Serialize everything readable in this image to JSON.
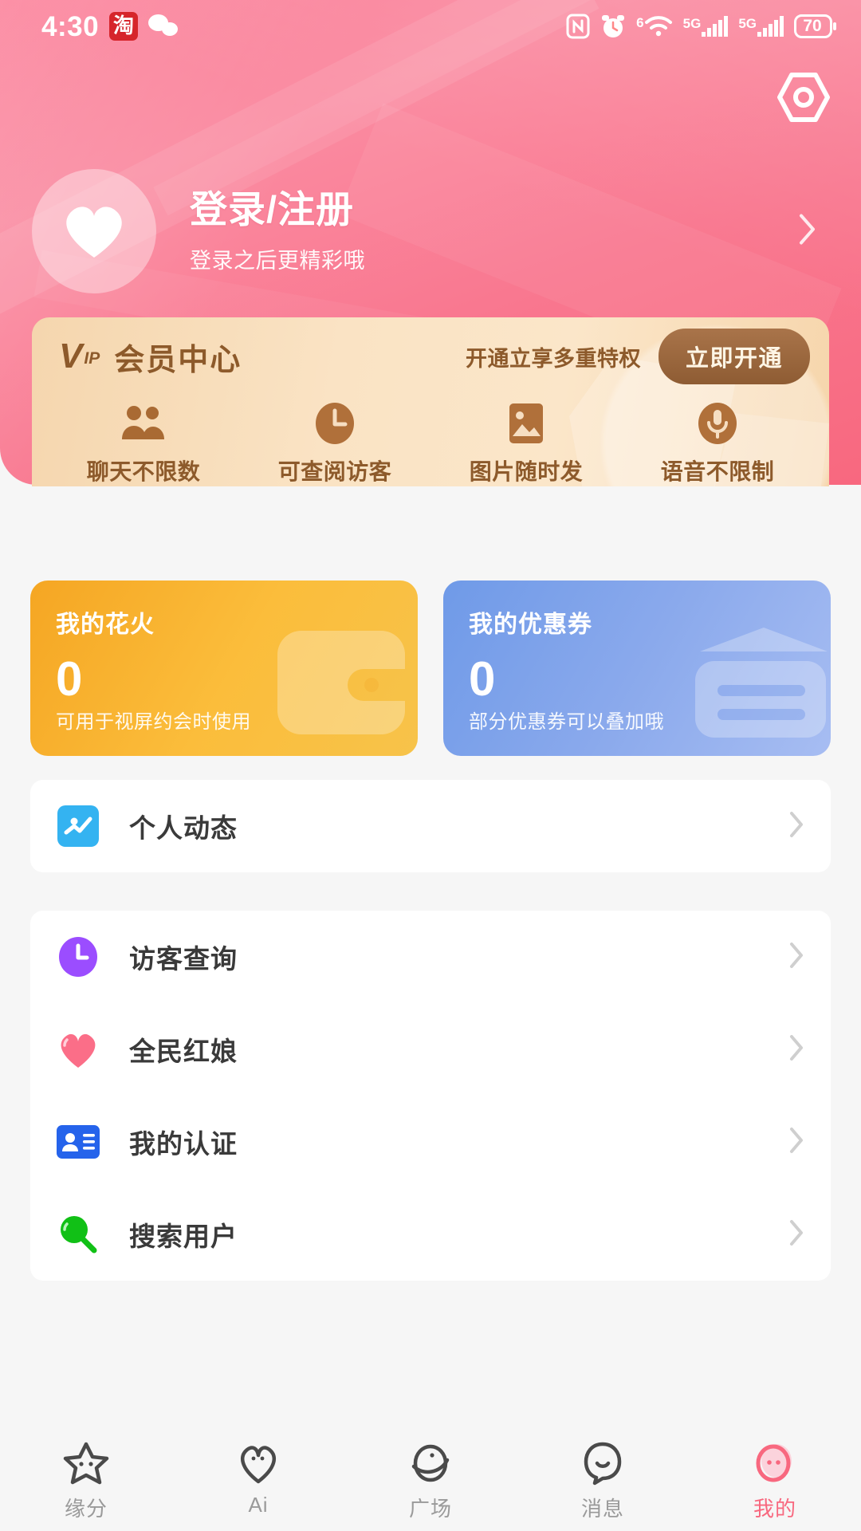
{
  "status_bar": {
    "time": "4:30",
    "left_icons": [
      "taobao-icon",
      "wechat-icon"
    ],
    "taobao_glyph": "淘",
    "right_icons": [
      "nfc-icon",
      "alarm-icon",
      "wifi-icon",
      "signal-icon",
      "signal-icon-2",
      "battery-icon"
    ],
    "wifi_label": "6",
    "network_label": "5G",
    "network_label_2": "5G",
    "battery_level": "70"
  },
  "header": {
    "settings_icon": "hex-settings-icon",
    "login_title": "登录/注册",
    "login_subtitle": "登录之后更精彩哦",
    "avatar_icon": "heart-icon",
    "arrow_icon": "chevron-right-icon",
    "bg_color": "#f8687f"
  },
  "vip": {
    "logo_v": "V",
    "logo_ip": "IP",
    "title": "会员中心",
    "slogan": "开通立享多重特权",
    "button_label": "立即开通",
    "accent_color": "#8d5a2b",
    "features": [
      {
        "icon": "people-icon",
        "label": "聊天不限数"
      },
      {
        "icon": "clock-icon",
        "label": "可查阅访客"
      },
      {
        "icon": "image-icon",
        "label": "图片随时发"
      },
      {
        "icon": "microphone-icon",
        "label": "语音不限制"
      }
    ]
  },
  "stats": [
    {
      "title": "我的花火",
      "value": "0",
      "desc": "可用于视屏约会时使用",
      "watermark": "wallet-icon",
      "color": "#f5a623"
    },
    {
      "title": "我的优惠券",
      "value": "0",
      "desc": "部分优惠券可以叠加哦",
      "watermark": "coupon-icon",
      "color": "#6f9ae8"
    }
  ],
  "menu_groups": [
    {
      "items": [
        {
          "label": "个人动态",
          "icon": "trend-chart-icon",
          "icon_color": "#34b3f1"
        }
      ]
    },
    {
      "items": [
        {
          "label": "访客查询",
          "icon": "clock-circle-icon",
          "icon_color": "#9b4dff"
        },
        {
          "label": "全民红娘",
          "icon": "heart-icon",
          "icon_color": "#fb6e88"
        },
        {
          "label": "我的认证",
          "icon": "id-card-icon",
          "icon_color": "#2563eb"
        },
        {
          "label": "搜索用户",
          "icon": "magnifier-icon",
          "icon_color": "#11c016"
        }
      ]
    }
  ],
  "tabbar": {
    "active_color": "#f8687f",
    "inactive_color": "#9a9a9a",
    "tabs": [
      {
        "label": "缘分",
        "icon": "star-face-icon",
        "active": false
      },
      {
        "label": "Ai",
        "icon": "heart-face-icon",
        "active": false
      },
      {
        "label": "广场",
        "icon": "planet-face-icon",
        "active": false
      },
      {
        "label": "消息",
        "icon": "chat-face-icon",
        "active": false
      },
      {
        "label": "我的",
        "icon": "profile-face-icon",
        "active": true
      }
    ]
  }
}
